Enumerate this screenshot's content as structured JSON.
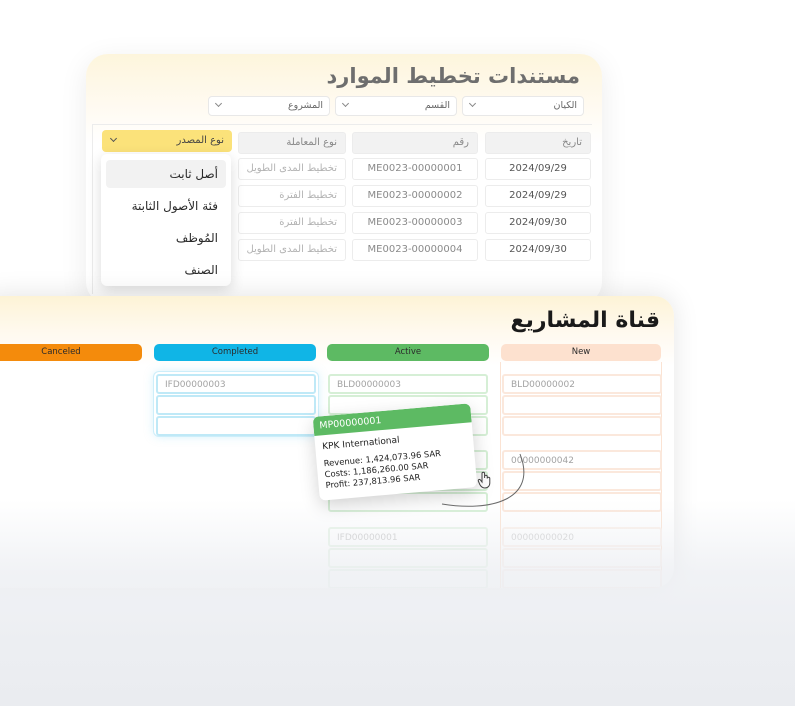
{
  "resource_planning": {
    "title": "مستندات تخطيط الموارد",
    "filters": [
      {
        "label": "الكيان"
      },
      {
        "label": "القسم"
      },
      {
        "label": "المشروع"
      }
    ],
    "source_select": {
      "label": "نوع المصدر"
    },
    "menu_items": [
      {
        "label": "أصل ثابت",
        "active": true
      },
      {
        "label": "فئة الأصول الثابتة"
      },
      {
        "label": "المُوظف"
      },
      {
        "label": "الصنف"
      }
    ],
    "columns": {
      "type": "نوع المعاملة",
      "number": "رقم",
      "date": "تاريخ"
    },
    "rows": [
      {
        "type": "تخطيط المدى الطويل",
        "number": "ME0023-00000001",
        "date": "2024/09/29"
      },
      {
        "type": "تخطيط الفترة",
        "number": "ME0023-00000002",
        "date": "2024/09/29"
      },
      {
        "type": "تخطيط الفترة",
        "number": "ME0023-00000003",
        "date": "2024/09/30"
      },
      {
        "type": "تخطيط المدى الطويل",
        "number": "ME0023-00000004",
        "date": "2024/09/30"
      }
    ]
  },
  "projects_pipeline": {
    "title": "قناة المشاريع",
    "columns": [
      {
        "label": "Canceled",
        "color": "#f48b0c"
      },
      {
        "label": "Completed",
        "color": "#10b5e6"
      },
      {
        "label": "Active",
        "color": "#5dba63"
      },
      {
        "label": "New",
        "color": "#fde1cf"
      }
    ],
    "completed_items": [
      "IFD00000003",
      "IFD00000001"
    ],
    "active_items": [
      "BLD00000003"
    ],
    "new_items": [
      "BLD00000002",
      "00000000042",
      "00000000020"
    ],
    "dragged_card": {
      "code": "MP00000001",
      "company": "KPK International",
      "revenue": "Revenue: 1,424,073.96 SAR",
      "costs": "Costs: 1,186,260.00 SAR",
      "profit": "Profit: 237,813.96 SAR"
    }
  }
}
